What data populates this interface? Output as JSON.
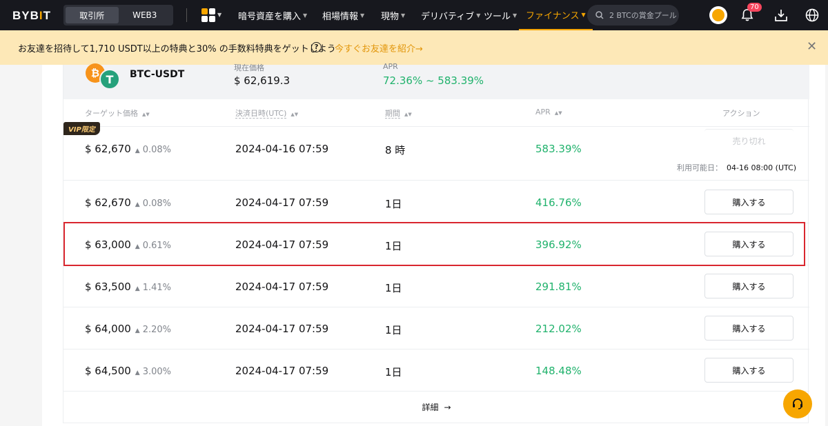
{
  "header": {
    "logo": {
      "text_a": "BYB",
      "text_b": "I",
      "text_c": "T"
    },
    "segment": {
      "exchange": "取引所",
      "web3": "WEB3"
    },
    "nav": [
      {
        "label": "暗号資産を購入"
      },
      {
        "label": "相場情報"
      },
      {
        "label": "現物"
      },
      {
        "label": "デリバティブ"
      },
      {
        "label": "ツール"
      },
      {
        "label": "ファイナンス"
      }
    ],
    "search": {
      "placeholder": "2 BTCの賞金プール"
    },
    "notifications_count": "70",
    "icons": [
      "apps-grid-icon",
      "search-icon",
      "avatar",
      "bell-icon",
      "download-icon",
      "globe-icon"
    ],
    "accent": "#f7a600"
  },
  "promo": {
    "text": "お友達を招待して1,710 USDT以上の特典と30% の手数料特典をゲットしよう",
    "help": "?",
    "link": "今すぐお友達を紹介",
    "link_arrow": "→",
    "close": "✕"
  },
  "product": {
    "pair": "BTC-USDT",
    "btc_symbol": "₿",
    "usdt_symbol": "T",
    "current_price_label": "現在価格",
    "current_price": "$ 62,619.3",
    "apr_label": "APR",
    "apr_range": "72.36% ~ 583.39%"
  },
  "table": {
    "headers": {
      "target_price": "ターゲット価格",
      "settlement": "決済日時(UTC)",
      "term": "期間",
      "apr": "APR",
      "action": "アクション"
    },
    "rows": [
      {
        "price": "$ 62,670",
        "change": "0.08%",
        "date": "2024-04-16 07:59",
        "term": "8 時",
        "apr": "583.39%",
        "vip": "VIP限定",
        "action": "売り切れ",
        "avail_label": "利用可能日：",
        "avail_value": "04-16 08:00 (UTC)"
      },
      {
        "price": "$ 62,670",
        "change": "0.08%",
        "date": "2024-04-17 07:59",
        "term": "1日",
        "apr": "416.76%",
        "action": "購入する"
      },
      {
        "price": "$ 63,000",
        "change": "0.61%",
        "date": "2024-04-17 07:59",
        "term": "1日",
        "apr": "396.92%",
        "action": "購入する"
      },
      {
        "price": "$ 63,500",
        "change": "1.41%",
        "date": "2024-04-17 07:59",
        "term": "1日",
        "apr": "291.81%",
        "action": "購入する"
      },
      {
        "price": "$ 64,000",
        "change": "2.20%",
        "date": "2024-04-17 07:59",
        "term": "1日",
        "apr": "212.02%",
        "action": "購入する"
      },
      {
        "price": "$ 64,500",
        "change": "3.00%",
        "date": "2024-04-17 07:59",
        "term": "1日",
        "apr": "148.48%",
        "action": "購入する"
      }
    ],
    "more": "詳細",
    "more_arrow": "→"
  },
  "colors": {
    "green": "#20b26c",
    "highlight_border": "#d9262e"
  }
}
